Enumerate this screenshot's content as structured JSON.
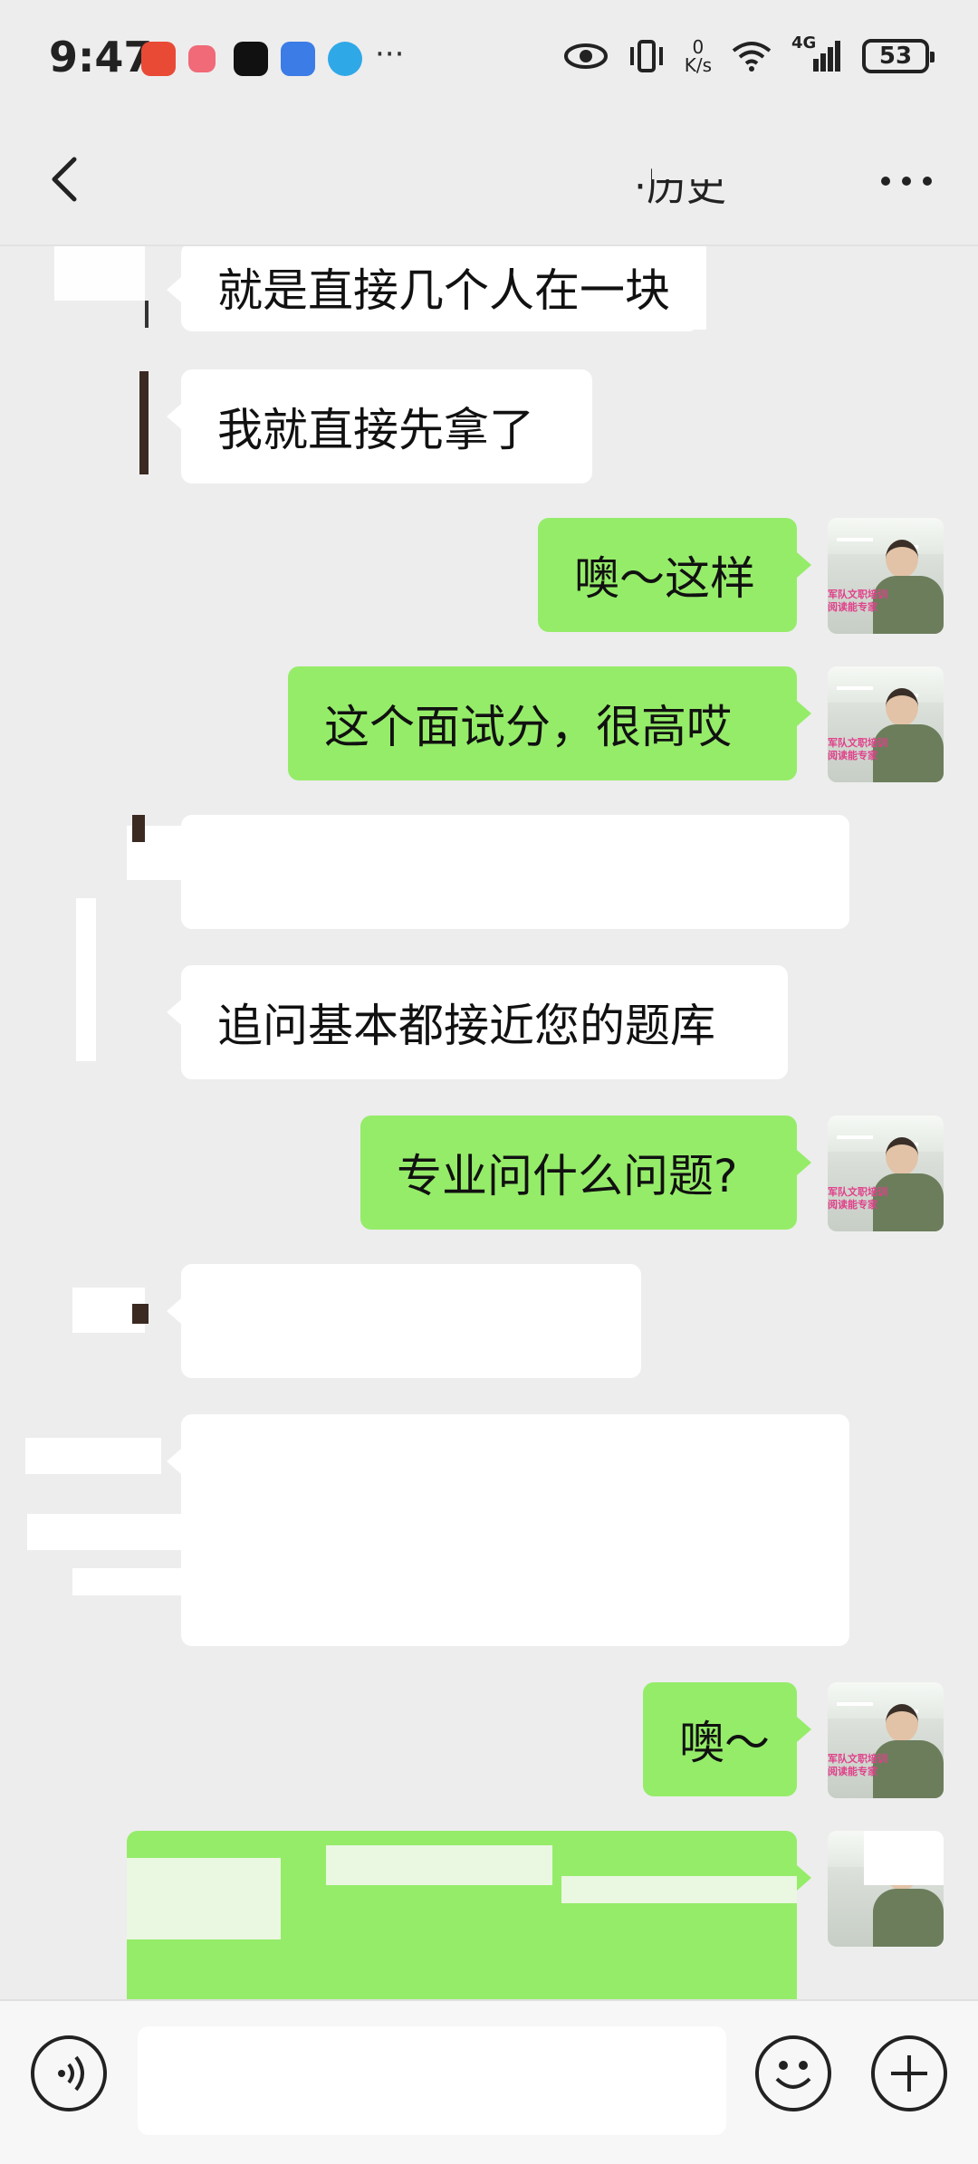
{
  "status_bar": {
    "time": "9:47",
    "net_speed_value": "0",
    "net_speed_unit": "K/s",
    "battery": "53",
    "network_type": "4G"
  },
  "header": {
    "title": "·历史",
    "back_icon": "chevron-left-icon",
    "more_icon": "more-dots-icon"
  },
  "messages": [
    {
      "side": "in",
      "text": "就是直接几个人在一块"
    },
    {
      "side": "in",
      "text": "我就直接先拿了"
    },
    {
      "side": "out",
      "text": "噢～这样"
    },
    {
      "side": "out",
      "text": "这个面试分，很高哎"
    },
    {
      "side": "in",
      "text": ""
    },
    {
      "side": "in",
      "text": "追问基本都接近您的题库"
    },
    {
      "side": "out",
      "text": "专业问什么问题?"
    },
    {
      "side": "in",
      "text": ""
    },
    {
      "side": "in",
      "text": ""
    },
    {
      "side": "out",
      "text": "噢～"
    },
    {
      "side": "out",
      "text": ""
    }
  ],
  "avatar_caption": "军队文职培训\n阅读能专家",
  "input_bar": {
    "voice_icon": "voice-icon",
    "emoji_icon": "emoji-icon",
    "plus_icon": "plus-icon"
  },
  "colors": {
    "background": "#ededed",
    "outgoing_bubble": "#95ec69",
    "incoming_bubble": "#ffffff"
  }
}
